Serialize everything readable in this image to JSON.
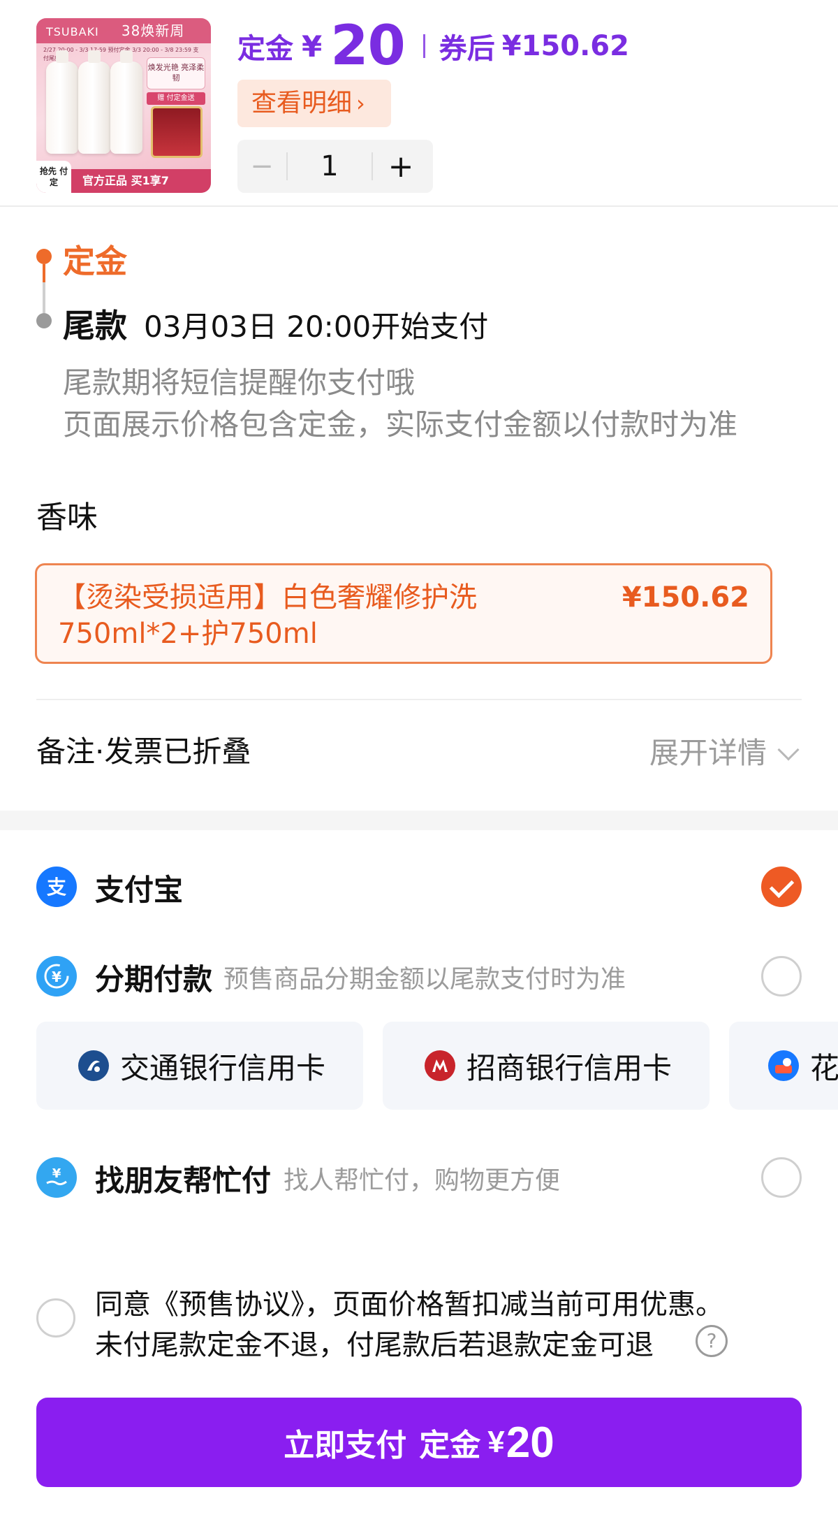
{
  "product": {
    "brand_text": "TSUBAKI",
    "campaign_tag": "38焕新周",
    "image_dates": "2/27 20:00 - 3/3 17:59 预付定金    3/3 20:00 - 3/8 23:59 支付尾款",
    "image_promo": "焕发光艳 亮泽柔韧",
    "image_gift_label": "赠 付定金送",
    "image_strip": "官方正品  买1享7",
    "image_corner": "抢先 付定",
    "deposit_label": "定金",
    "currency": "¥",
    "deposit_amount": "20",
    "after_coupon_label": "券后",
    "after_coupon_price": "¥150.62",
    "detail_button": "查看明细",
    "detail_chevron": "›",
    "quantity": "1",
    "minus": "−",
    "plus": "+"
  },
  "timeline": {
    "deposit_step": "定金",
    "balance_step": "尾款",
    "balance_time": "03月03日 20:00开始支付",
    "note_1": "尾款期将短信提醒你支付哦",
    "note_2": "页面展示价格包含定金，实际支付金额以付款时为准"
  },
  "option": {
    "title": "香味",
    "selected_name": "【烫染受损适用】白色奢耀修护洗750ml*2+护750ml",
    "selected_price": "¥150.62"
  },
  "remark": {
    "label": "备注·发票已折叠",
    "expand": "展开详情"
  },
  "payments": {
    "alipay": {
      "label": "支付宝",
      "icon": "alipay-icon",
      "selected": true
    },
    "installment": {
      "label": "分期付款",
      "sub": "预售商品分期金额以尾款支付时为准",
      "icon": "installment-icon",
      "selected": false
    },
    "banks": [
      {
        "name": "交通银行信用卡",
        "icon": "bocom-icon"
      },
      {
        "name": "招商银行信用卡",
        "icon": "cmb-icon"
      },
      {
        "name": "花",
        "icon": "huabei-icon"
      }
    ],
    "friend": {
      "label": "找朋友帮忙付",
      "sub": "找人帮忙付，购物更方便",
      "icon": "friend-pay-icon",
      "selected": false
    }
  },
  "agreement": {
    "line1": "同意《预售协议》，页面价格暂扣减当前可用优惠。",
    "line2": "未付尾款定金不退，付尾款后若退款定金可退",
    "help": "?"
  },
  "submit": {
    "label": "立即支付",
    "deposit_label": "定金",
    "currency": "¥",
    "amount": "20"
  },
  "colors": {
    "purple": "#7a2de1",
    "button_purple": "#8a1ef0",
    "orange": "#ee6b2a",
    "alipay_blue": "#1678ff"
  }
}
